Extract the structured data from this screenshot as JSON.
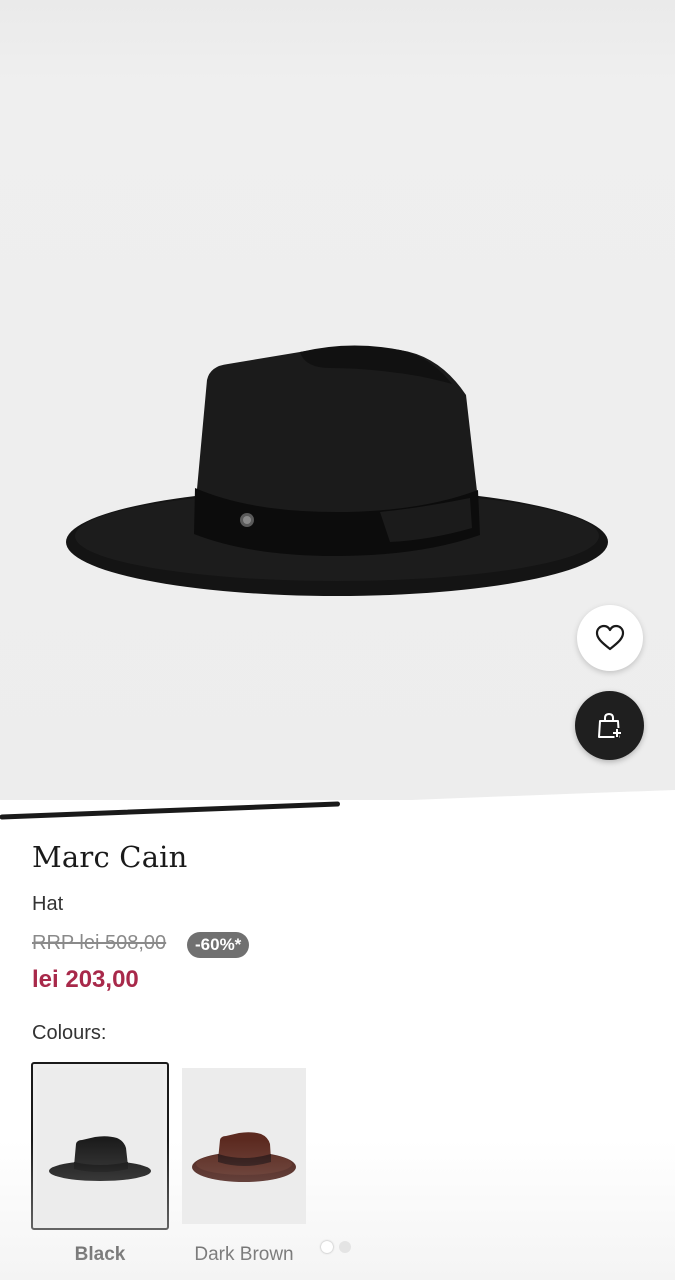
{
  "gallery": {
    "image_alt": "Black wide-brim fedora hat",
    "progress": 0.5,
    "page_indicator": {
      "total": 2,
      "active": 1
    }
  },
  "actions": {
    "wishlist_icon": "heart-outline-icon",
    "add_to_bag_icon": "shopping-bag-plus-icon"
  },
  "product": {
    "brand": "Marc Cain",
    "type": "Hat",
    "rrp_text": "RRP lei 508,00",
    "discount_badge": "-60%*",
    "price": "lei 203,00",
    "price_color": "#a8294a"
  },
  "colours": {
    "label": "Colours:",
    "options": [
      {
        "name": "Black",
        "selected": true
      },
      {
        "name": "Dark Brown",
        "selected": false
      }
    ]
  }
}
